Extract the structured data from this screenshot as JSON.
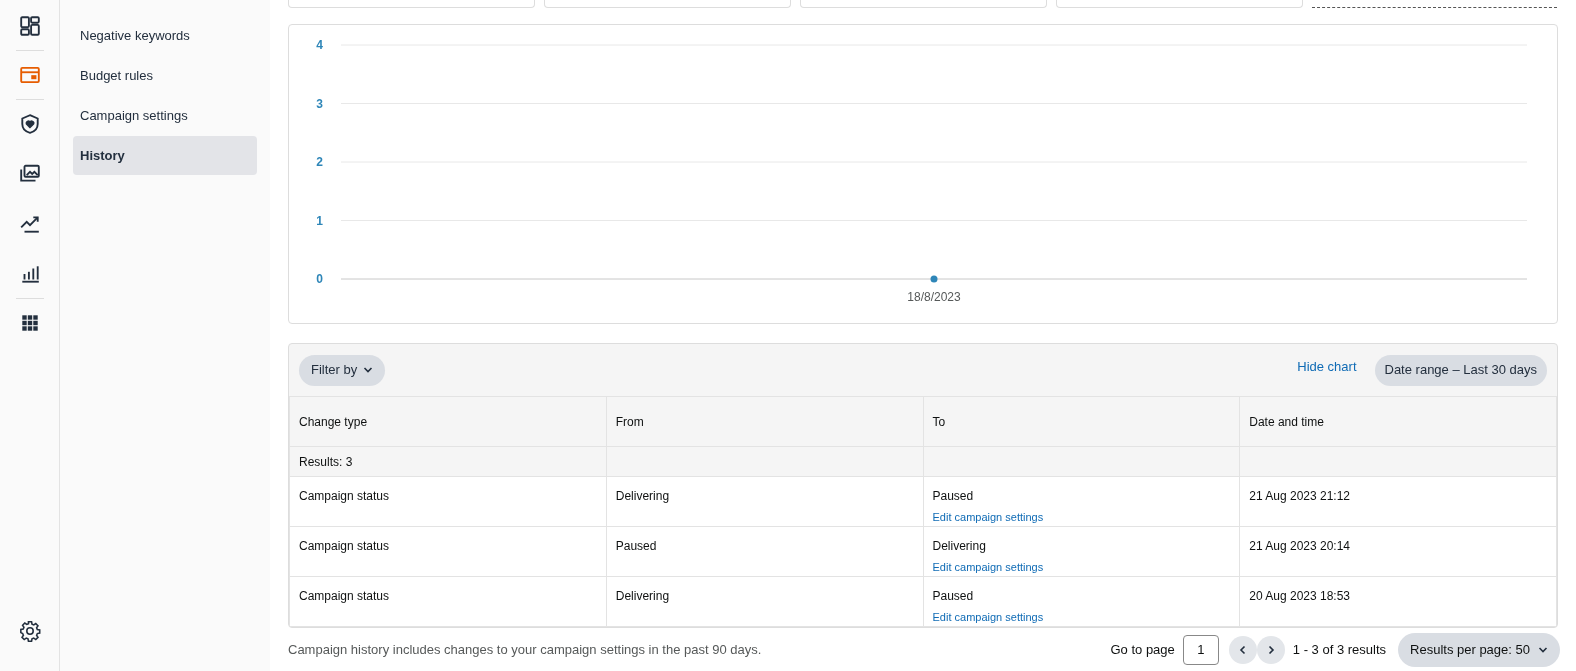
{
  "rail": {
    "items": [
      {
        "kind": "dashboard",
        "selected": false
      },
      {
        "kind": "wallet",
        "selected": true
      },
      {
        "kind": "shield",
        "selected": false
      },
      {
        "kind": "media",
        "selected": false
      },
      {
        "kind": "trend",
        "selected": false
      },
      {
        "kind": "bars",
        "selected": false
      },
      {
        "kind": "apps",
        "selected": false
      }
    ]
  },
  "sidebar": {
    "items": [
      {
        "label": "Negative keywords",
        "selected": false
      },
      {
        "label": "Budget rules",
        "selected": false
      },
      {
        "label": "Campaign settings",
        "selected": false
      },
      {
        "label": "History",
        "selected": true
      }
    ]
  },
  "chart": {
    "chart_data": {
      "type": "line",
      "categories": [
        "18/8/2023"
      ],
      "series": [
        {
          "color": "#2e86b8",
          "marker": true,
          "values": [
            0
          ]
        }
      ],
      "yticks": [
        0,
        1,
        2,
        3,
        4
      ],
      "ylim": [
        0,
        4
      ],
      "grid": true
    }
  },
  "toolbar": {
    "filter": "Filter by",
    "hide_chart": "Hide chart",
    "date_range": "Date range – Last 30 days"
  },
  "table": {
    "columns": [
      "Change type",
      "From",
      "To",
      "Date and time"
    ],
    "results": "Results: 3",
    "rows": [
      {
        "change_type": "Campaign status",
        "from": "Delivering",
        "to": "Paused",
        "link": "Edit campaign settings",
        "date": "21 Aug 2023 21:12"
      },
      {
        "change_type": "Campaign status",
        "from": "Paused",
        "to": "Delivering",
        "link": "Edit campaign settings",
        "date": "21 Aug 2023 20:14"
      },
      {
        "change_type": "Campaign status",
        "from": "Delivering",
        "to": "Paused",
        "link": "Edit campaign settings",
        "date": "20 Aug 2023 18:53"
      }
    ]
  },
  "footer": {
    "note": "Campaign history includes changes to your campaign settings in the past 90 days.",
    "go_to_page": "Go to page",
    "page": "1",
    "range": "1 - 3 of 3 results",
    "per_page": "Results per page: 50"
  }
}
